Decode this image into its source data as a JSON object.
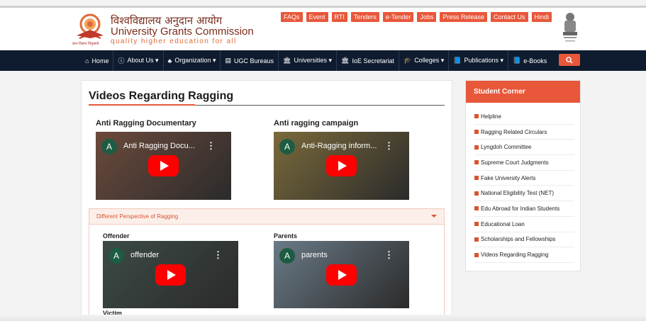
{
  "header": {
    "title_hindi": "विश्वविद्यालय अनुदान आयोग",
    "title_english": "University Grants Commission",
    "tagline": "quality higher education for all",
    "logo_tagline": "ज्ञान-विज्ञान विमुक्तये",
    "top_links": [
      "FAQs",
      "Event",
      "RTI",
      "Tenders",
      "e-Tender",
      "Jobs",
      "Press Release",
      "Contact Us",
      "Hindi"
    ]
  },
  "nav": {
    "items": [
      {
        "label": "Home",
        "icon": "home-icon",
        "glyph": "⌂"
      },
      {
        "label": "About Us ▾",
        "icon": "info-icon",
        "glyph": "ⓘ"
      },
      {
        "label": "Organization ▾",
        "icon": "sitemap-icon",
        "glyph": "♣"
      },
      {
        "label": "UGC Bureaus",
        "icon": "document-icon",
        "glyph": "▤"
      },
      {
        "label": "Universities ▾",
        "icon": "institution-icon",
        "glyph": "🏛"
      },
      {
        "label": "IoE Secretariat",
        "icon": "institution-icon",
        "glyph": "🏛"
      },
      {
        "label": "Colleges ▾",
        "icon": "graduation-cap-icon",
        "glyph": "🎓"
      },
      {
        "label": "Publications ▾",
        "icon": "book-icon",
        "glyph": "📘"
      },
      {
        "label": "e-Books",
        "icon": "book-icon",
        "glyph": "📘"
      }
    ],
    "search_icon": "search-icon"
  },
  "main": {
    "title": "Videos Regarding Ragging",
    "videos": [
      {
        "heading": "Anti Ragging Documentary",
        "video_title": "Anti Ragging Docu...",
        "avatar": "A",
        "bg": "#6b4a3c"
      },
      {
        "heading": "Anti ragging campaign",
        "video_title": "Anti-Ragging inform...",
        "avatar": "A",
        "bg": "#7a6a3a"
      }
    ],
    "accordion": {
      "title": "Different Perspective of Ragging",
      "videos": [
        {
          "heading": "Offender",
          "video_title": "offender",
          "avatar": "A",
          "bg": "#3c4a45"
        },
        {
          "heading": "Parents",
          "video_title": "parents",
          "avatar": "A",
          "bg": "#6a7a86"
        }
      ],
      "next_heading": "Victim"
    }
  },
  "sidebar": {
    "title": "Student Corner",
    "items": [
      "Helpline",
      "Ragging Related Circulars",
      "Lyngdoh Committee",
      "Supreme Court Judgments",
      "Fake University Alerts",
      "National Eligibility Test (NET)",
      "Edu Abroad for Indian Students",
      "Educational Loan",
      "Scholarships and Fellowships",
      "Videos Regarding Ragging"
    ]
  },
  "colors": {
    "accent": "#e8573a",
    "nav_bg": "#0f1c30",
    "brand_text": "#7a2b1b"
  }
}
